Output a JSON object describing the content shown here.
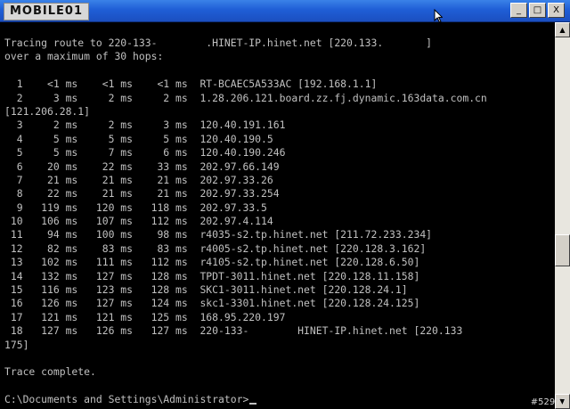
{
  "window": {
    "logo_text": "MOBILE01",
    "buttons": {
      "minimize": "_",
      "maximize": "□",
      "close": "X"
    }
  },
  "console": {
    "lines": [
      "Tracing route to 220-133-        .HINET-IP.hinet.net [220.133.       ]",
      "over a maximum of 30 hops:",
      "",
      "  1    <1 ms    <1 ms    <1 ms  RT-BCAEC5A533AC [192.168.1.1]",
      "  2     3 ms     2 ms     2 ms  1.28.206.121.board.zz.fj.dynamic.163data.com.cn",
      "[121.206.28.1]",
      "  3     2 ms     2 ms     3 ms  120.40.191.161",
      "  4     5 ms     5 ms     5 ms  120.40.190.5",
      "  5     5 ms     7 ms     6 ms  120.40.190.246",
      "  6    20 ms    22 ms    33 ms  202.97.66.149",
      "  7    21 ms    21 ms    21 ms  202.97.33.26",
      "  8    22 ms    21 ms    21 ms  202.97.33.254",
      "  9   119 ms   120 ms   118 ms  202.97.33.5",
      " 10   106 ms   107 ms   112 ms  202.97.4.114",
      " 11    94 ms   100 ms    98 ms  r4035-s2.tp.hinet.net [211.72.233.234]",
      " 12    82 ms    83 ms    83 ms  r4005-s2.tp.hinet.net [220.128.3.162]",
      " 13   102 ms   111 ms   112 ms  r4105-s2.tp.hinet.net [220.128.6.50]",
      " 14   132 ms   127 ms   128 ms  TPDT-3011.hinet.net [220.128.11.158]",
      " 15   116 ms   123 ms   128 ms  SKC1-3011.hinet.net [220.128.24.1]",
      " 16   126 ms   127 ms   124 ms  skc1-3301.hinet.net [220.128.24.125]",
      " 17   121 ms   121 ms   125 ms  168.95.220.197",
      " 18   127 ms   126 ms   127 ms  220-133-        HINET-IP.hinet.net [220.133",
      "175]",
      "",
      "Trace complete.",
      "",
      "C:\\Documents and Settings\\Administrator>"
    ]
  },
  "watermark": "#52977",
  "icons": {
    "mouse_pointer": "mouse-pointer-icon",
    "scroll_up": "scroll-up-arrow-icon",
    "scroll_down": "scroll-down-arrow-icon"
  }
}
